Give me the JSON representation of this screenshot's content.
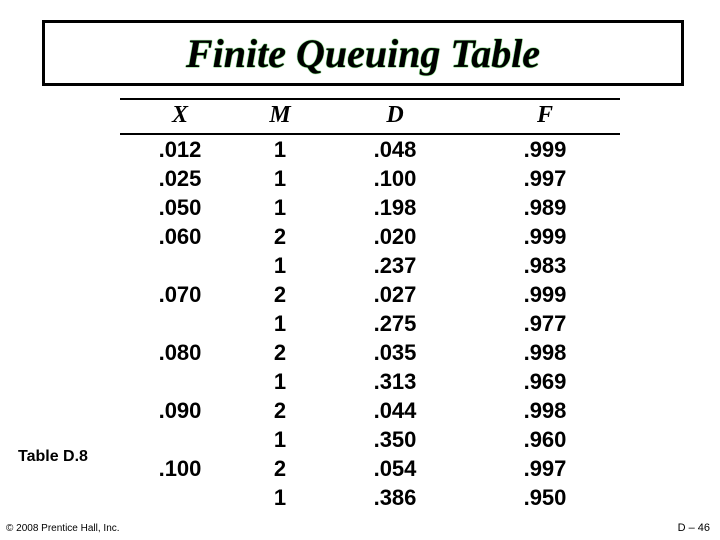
{
  "title": "Finite Queuing Table",
  "chart_data": {
    "type": "table",
    "title": "Finite Queuing Table",
    "columns": [
      "X",
      "M",
      "D",
      "F"
    ],
    "rows": [
      [
        ".012",
        "1",
        ".048",
        ".999"
      ],
      [
        ".025",
        "1",
        ".100",
        ".997"
      ],
      [
        ".050",
        "1",
        ".198",
        ".989"
      ],
      [
        ".060",
        "2",
        ".020",
        ".999"
      ],
      [
        "",
        "1",
        ".237",
        ".983"
      ],
      [
        ".070",
        "2",
        ".027",
        ".999"
      ],
      [
        "",
        "1",
        ".275",
        ".977"
      ],
      [
        ".080",
        "2",
        ".035",
        ".998"
      ],
      [
        "",
        "1",
        ".313",
        ".969"
      ],
      [
        ".090",
        "2",
        ".044",
        ".998"
      ],
      [
        "",
        "1",
        ".350",
        ".960"
      ],
      [
        ".100",
        "2",
        ".054",
        ".997"
      ],
      [
        "",
        "1",
        ".386",
        ".950"
      ]
    ]
  },
  "columns": {
    "c0": "X",
    "c1": "M",
    "c2": "D",
    "c3": "F"
  },
  "r0": {
    "x": ".012",
    "m": "1",
    "d": ".048",
    "f": ".999"
  },
  "r1": {
    "x": ".025",
    "m": "1",
    "d": ".100",
    "f": ".997"
  },
  "r2": {
    "x": ".050",
    "m": "1",
    "d": ".198",
    "f": ".989"
  },
  "r3": {
    "x": ".060",
    "m": "2",
    "d": ".020",
    "f": ".999"
  },
  "r4": {
    "x": "",
    "m": "1",
    "d": ".237",
    "f": ".983"
  },
  "r5": {
    "x": ".070",
    "m": "2",
    "d": ".027",
    "f": ".999"
  },
  "r6": {
    "x": "",
    "m": "1",
    "d": ".275",
    "f": ".977"
  },
  "r7": {
    "x": ".080",
    "m": "2",
    "d": ".035",
    "f": ".998"
  },
  "r8": {
    "x": "",
    "m": "1",
    "d": ".313",
    "f": ".969"
  },
  "r9": {
    "x": ".090",
    "m": "2",
    "d": ".044",
    "f": ".998"
  },
  "r10": {
    "x": "",
    "m": "1",
    "d": ".350",
    "f": ".960"
  },
  "r11": {
    "x": ".100",
    "m": "2",
    "d": ".054",
    "f": ".997"
  },
  "r12": {
    "x": "",
    "m": "1",
    "d": ".386",
    "f": ".950"
  },
  "table_label": "Table D.8",
  "copyright": "© 2008 Prentice Hall, Inc.",
  "pagenum": "D – 46"
}
